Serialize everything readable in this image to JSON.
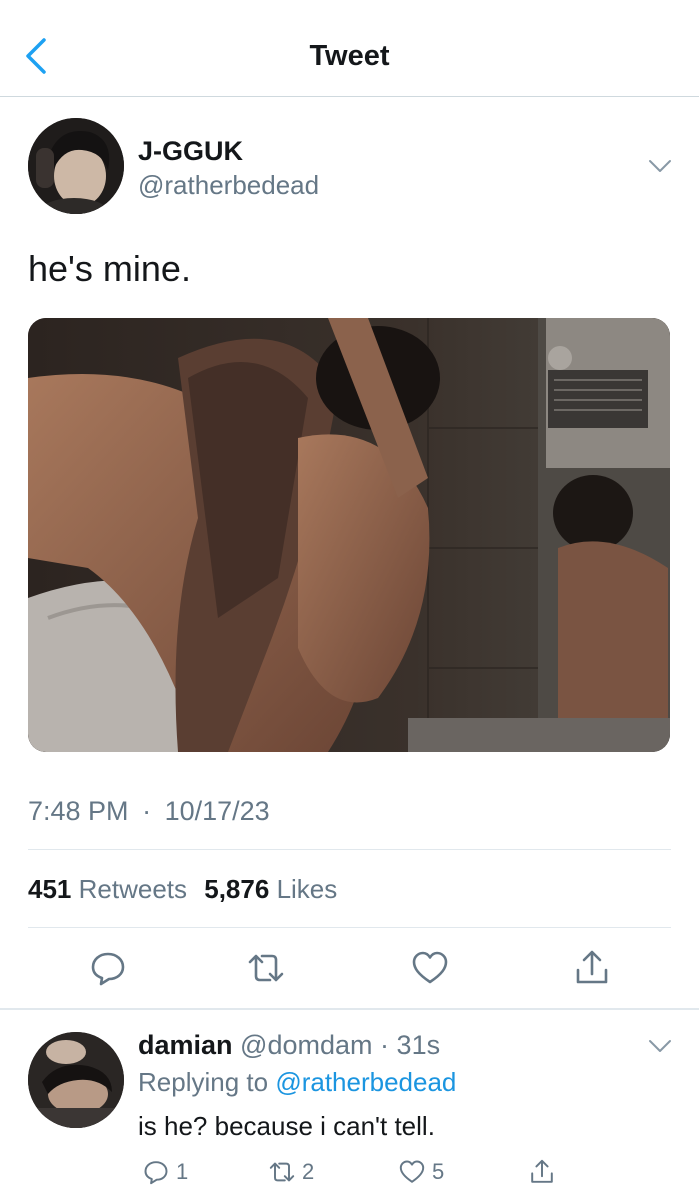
{
  "nav": {
    "title": "Tweet"
  },
  "tweet": {
    "author_name": "J-GGUK",
    "author_handle": "@ratherbedead",
    "text": "he's mine.",
    "time": "7:48 PM",
    "separator": "·",
    "date": "10/17/23",
    "retweets_count": "451",
    "retweets_label": "Retweets",
    "likes_count": "5,876",
    "likes_label": "Likes"
  },
  "reply": {
    "author_name": "damian",
    "author_handle": "@domdam",
    "separator": "·",
    "time": "31s",
    "replying_prefix": "Replying to",
    "replying_handle": "@ratherbedead",
    "text": "is he? because i can't tell.",
    "reply_count": "1",
    "retweet_count": "2",
    "like_count": "5"
  },
  "icons": {
    "back": "chevron-left-icon",
    "menu": "chevron-down-icon",
    "reply": "comment-icon",
    "retweet": "retweet-icon",
    "like": "heart-icon",
    "share": "share-icon"
  },
  "colors": {
    "accent": "#1da1f2",
    "mention": "#1b95e0",
    "secondary_text": "#657786",
    "icon": "#657786"
  }
}
